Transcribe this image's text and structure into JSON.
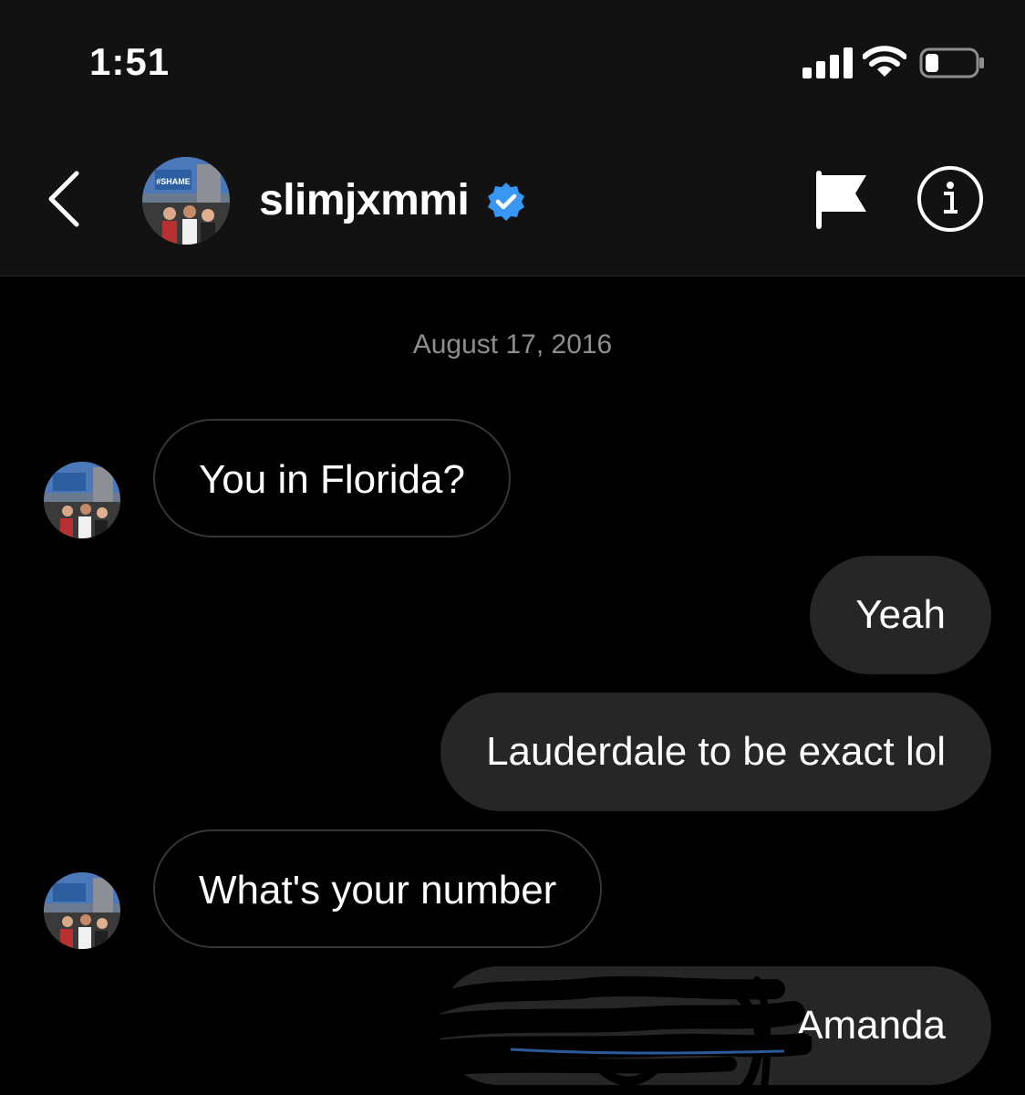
{
  "status_bar": {
    "time": "1:51",
    "signal_icon": "cellular-signal-icon",
    "wifi_icon": "wifi-icon",
    "battery_icon": "battery-low-icon"
  },
  "header": {
    "username": "slimjxmmi",
    "verified_icon": "verified-badge-icon",
    "avatar_sign_text": "#SHAME"
  },
  "thread": {
    "date_separator": "August 17, 2016",
    "messages": [
      {
        "from": "them",
        "text": "You in Florida?"
      },
      {
        "from": "me",
        "text": "Yeah"
      },
      {
        "from": "me",
        "text": "Lauderdale to be exact lol"
      },
      {
        "from": "them",
        "text": "What's your number"
      },
      {
        "from": "me",
        "text": "Amanda"
      }
    ]
  },
  "colors": {
    "background": "#000000",
    "header_background": "#121212",
    "outgoing_bubble": "#262626",
    "incoming_border": "#363636",
    "timestamp": "#8e8e8e",
    "verified_blue": "#3897f0"
  }
}
